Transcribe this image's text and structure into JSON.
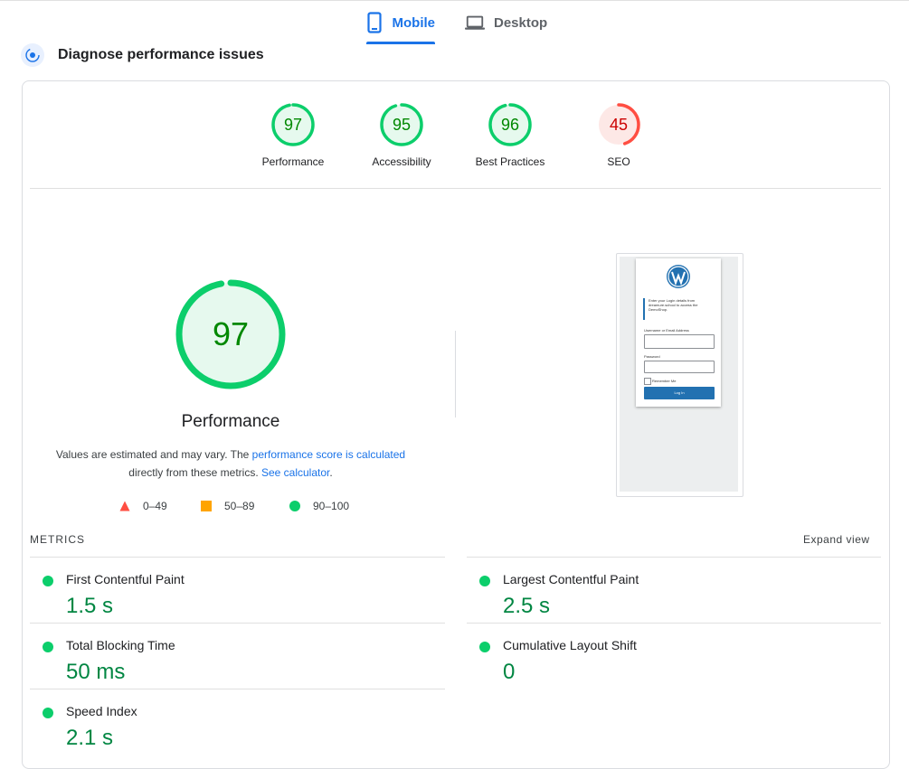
{
  "tabs": [
    {
      "label": "Mobile",
      "icon": "smartphone-icon",
      "selected": true
    },
    {
      "label": "Desktop",
      "icon": "laptop-icon",
      "selected": false
    }
  ],
  "section": {
    "title": "Diagnose performance issues",
    "icon": "diagnose-icon"
  },
  "categories": [
    {
      "label": "Performance",
      "score": "97",
      "level": 0.97,
      "color": "#0cce6b",
      "text_color": "#008800",
      "fill": "#e6f9ee"
    },
    {
      "label": "Accessibility",
      "score": "95",
      "level": 0.95,
      "color": "#0cce6b",
      "text_color": "#008800",
      "fill": "#e6f9ee"
    },
    {
      "label": "Best Practices",
      "score": "96",
      "level": 0.96,
      "color": "#0cce6b",
      "text_color": "#008800",
      "fill": "#e6f9ee"
    },
    {
      "label": "SEO",
      "score": "45",
      "level": 0.45,
      "color": "#ff4e42",
      "text_color": "#cc0000",
      "fill": "#fde8e6"
    }
  ],
  "main_score": {
    "score": "97",
    "level": 0.97,
    "title": "Performance",
    "color": "#0cce6b",
    "text_color": "#008800",
    "fill": "#e6f9ee"
  },
  "description": {
    "part1": "Values are estimated and may vary. The ",
    "link1": "performance score is calculated",
    "part2": "directly from these metrics. ",
    "link2": "See calculator",
    "part3": "."
  },
  "legend": [
    {
      "range": "0–49",
      "shape": "triangle",
      "color": "#ff4e42"
    },
    {
      "range": "50–89",
      "shape": "square",
      "color": "#ffa400"
    },
    {
      "range": "90–100",
      "shape": "circle",
      "color": "#0cce6b"
    }
  ],
  "screenshot": {
    "message": "Enter your Login details from dreamure.school to access the DemoShop.",
    "username_label": "Username or Email Address",
    "password_label": "Password",
    "remember_label": "Remember Me",
    "button_label": "Log In"
  },
  "metrics": {
    "heading": "METRICS",
    "expand_label": "Expand view",
    "items": [
      {
        "name": "First Contentful Paint",
        "value": "1.5 s"
      },
      {
        "name": "Largest Contentful Paint",
        "value": "2.5 s"
      },
      {
        "name": "Total Blocking Time",
        "value": "50 ms"
      },
      {
        "name": "Cumulative Layout Shift",
        "value": "0"
      },
      {
        "name": "Speed Index",
        "value": "2.1 s"
      }
    ]
  }
}
